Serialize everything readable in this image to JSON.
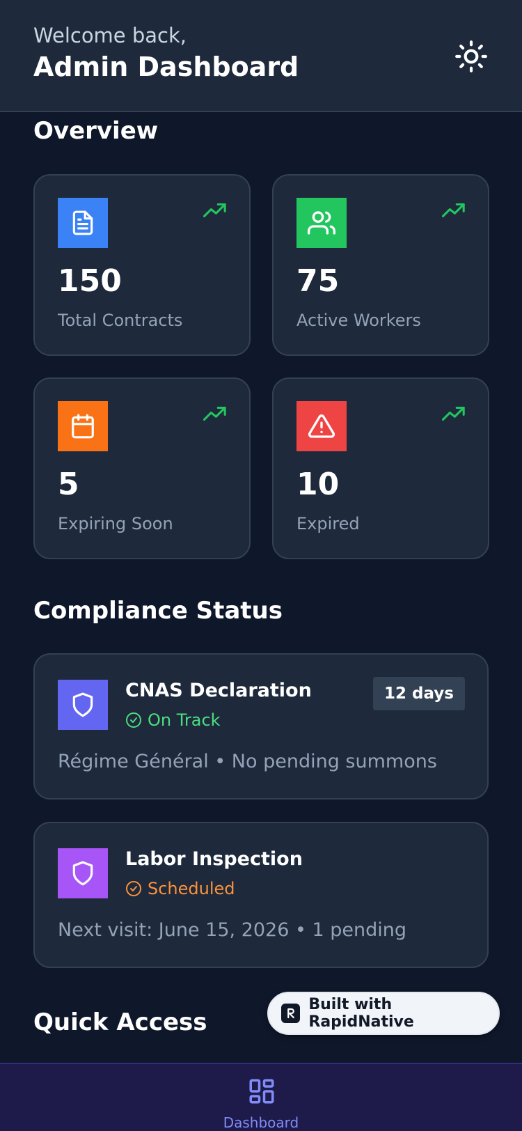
{
  "header": {
    "welcome": "Welcome back,",
    "title": "Admin Dashboard",
    "theme_icon": "sun-icon"
  },
  "overview": {
    "title": "Overview",
    "cards": [
      {
        "value": "150",
        "label": "Total Contracts",
        "icon": "document-icon",
        "color": "#3b82f6"
      },
      {
        "value": "75",
        "label": "Active Workers",
        "icon": "users-icon",
        "color": "#22c55e"
      },
      {
        "value": "5",
        "label": "Expiring Soon",
        "icon": "calendar-icon",
        "color": "#f97316"
      },
      {
        "value": "10",
        "label": "Expired",
        "icon": "warning-icon",
        "color": "#ef4444"
      }
    ],
    "trend_color": "#22c55e"
  },
  "compliance": {
    "title": "Compliance Status",
    "items": [
      {
        "title": "CNAS Declaration",
        "status": "On Track",
        "status_color": "#4ade80",
        "badge": "12 days",
        "description": "Régime Général • No pending summons",
        "icon_color": "#6366f1"
      },
      {
        "title": "Labor Inspection",
        "status": "Scheduled",
        "status_color": "#fb923c",
        "description": "Next visit: June 15, 2026 • 1 pending",
        "icon_color": "#a855f7"
      }
    ]
  },
  "quick_access": {
    "title": "Quick Access"
  },
  "built_badge": {
    "label": "Built with RapidNative"
  },
  "bottom_nav": {
    "items": [
      {
        "label": "Dashboard",
        "icon": "grid-icon",
        "active": true
      }
    ]
  }
}
